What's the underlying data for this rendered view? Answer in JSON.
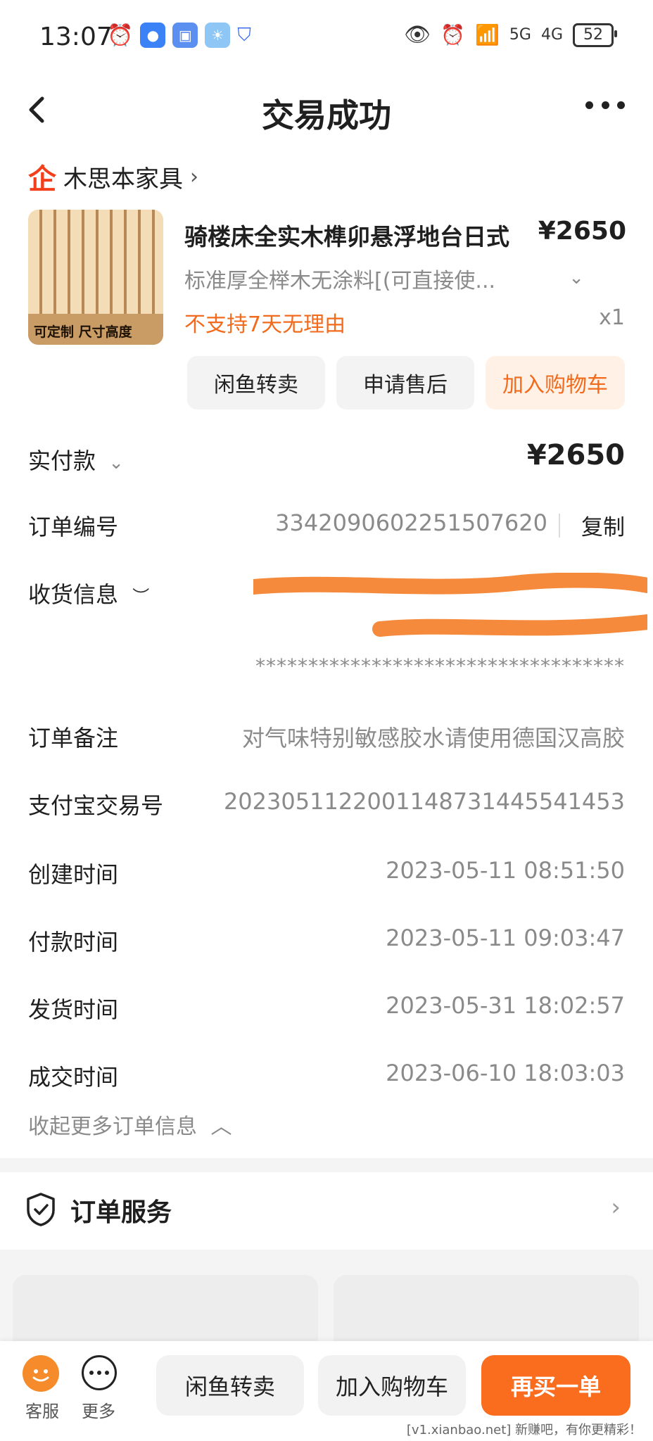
{
  "status_bar": {
    "time": "13:07",
    "signal_5g": "5G",
    "signal_4g": "4G",
    "battery": "52"
  },
  "nav": {
    "title": "交易成功"
  },
  "shop": {
    "name": "木思本家具"
  },
  "product": {
    "image_caption": "可定制 尺寸高度",
    "title": "骑楼床全实木榫卯悬浮地台日式",
    "price": "¥2650",
    "spec": "标准厚全榉木无涂料[(可直接使...",
    "warning": "不支持7天无理由",
    "quantity": "x1",
    "actions": [
      "闲鱼转卖",
      "申请售后",
      "加入购物车"
    ]
  },
  "payment": {
    "label": "实付款",
    "amount": "¥2650"
  },
  "order": {
    "number_label": "订单编号",
    "number": "3342090602251507620",
    "copy_label": "复制",
    "shipping_label": "收货信息",
    "shipping_masked": "***********************************",
    "note_label": "订单备注",
    "note": "对气味特别敏感胶水请使用德国汉高胶",
    "alipay_label": "支付宝交易号",
    "alipay_no": "2023051122001148731445541453",
    "created_label": "创建时间",
    "created": "2023-05-11 08:51:50",
    "paid_label": "付款时间",
    "paid": "2023-05-11 09:03:47",
    "shipped_label": "发货时间",
    "shipped": "2023-05-31 18:02:57",
    "closed_label": "成交时间",
    "closed": "2023-06-10 18:03:03",
    "collapse_label": "收起更多订单信息"
  },
  "service": {
    "label": "订单服务"
  },
  "bottom_bar": {
    "customer_service": "客服",
    "more": "更多",
    "resell": "闲鱼转卖",
    "add_cart": "加入购物车",
    "rebuy": "再买一单"
  },
  "watermark": "[v1.xianbao.net] 新赚吧，有你更精彩！",
  "colors": {
    "accent_orange": "#fa6c1e",
    "warning_orange": "#f26b1d",
    "shop_red": "#f43f1c",
    "scribble": "#f58a3c"
  }
}
